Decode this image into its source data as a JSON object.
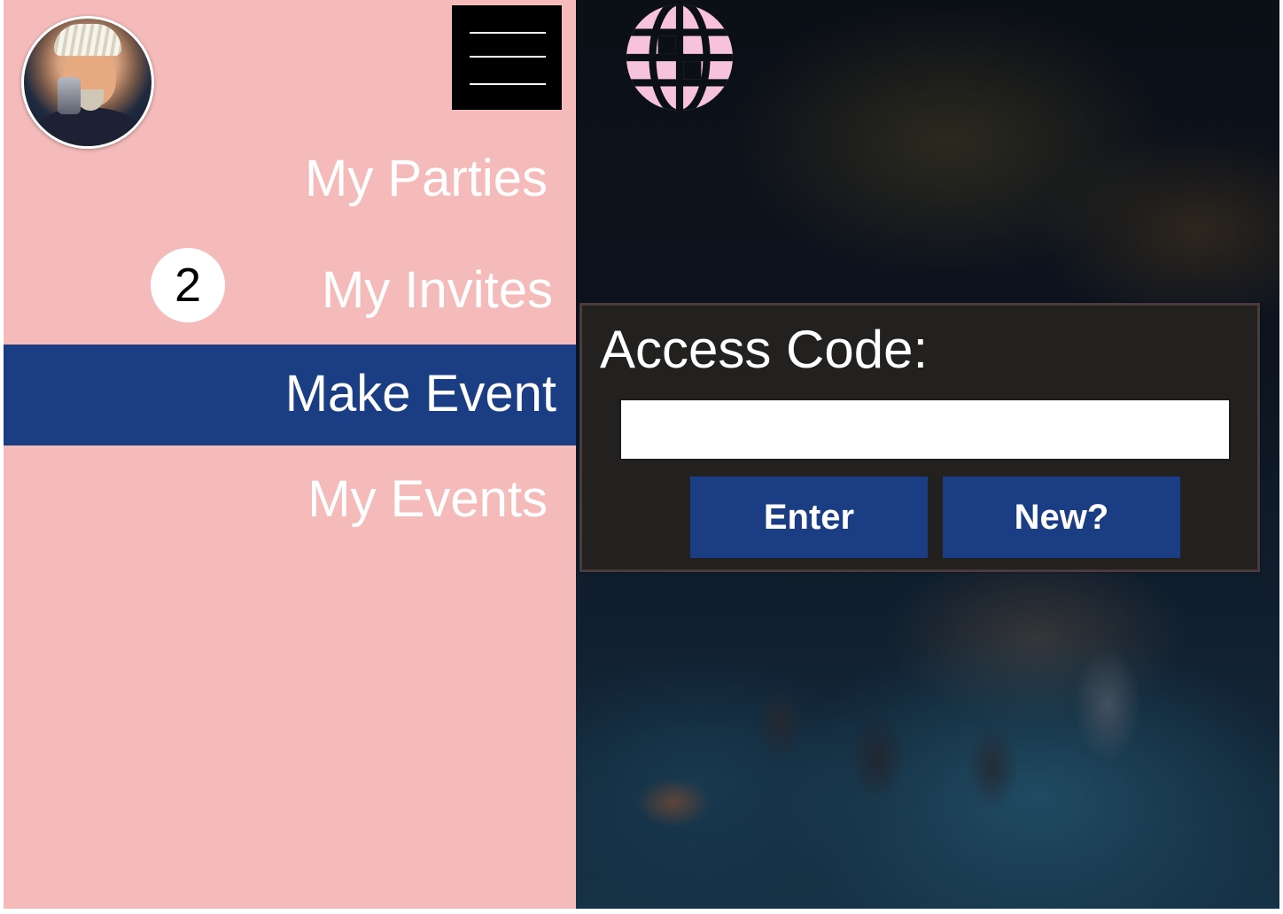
{
  "sidebar": {
    "avatar_icon": "user-avatar",
    "menu_icon": "hamburger-menu-icon",
    "items": [
      {
        "label": "My Parties"
      },
      {
        "label": "My Invites",
        "badge": "2"
      },
      {
        "label": "Make Event",
        "active": true
      },
      {
        "label": "My Events"
      }
    ]
  },
  "main": {
    "logo_icon": "globe-logo-icon",
    "access": {
      "label": "Access Code:",
      "input_value": "",
      "input_placeholder": "",
      "enter_label": "Enter",
      "new_label": "New?"
    }
  },
  "colors": {
    "sidebar_bg": "#f5bbbb",
    "accent_blue": "#1a3d84",
    "panel_bg": "#222120",
    "logo_pink": "#f7c2db"
  }
}
